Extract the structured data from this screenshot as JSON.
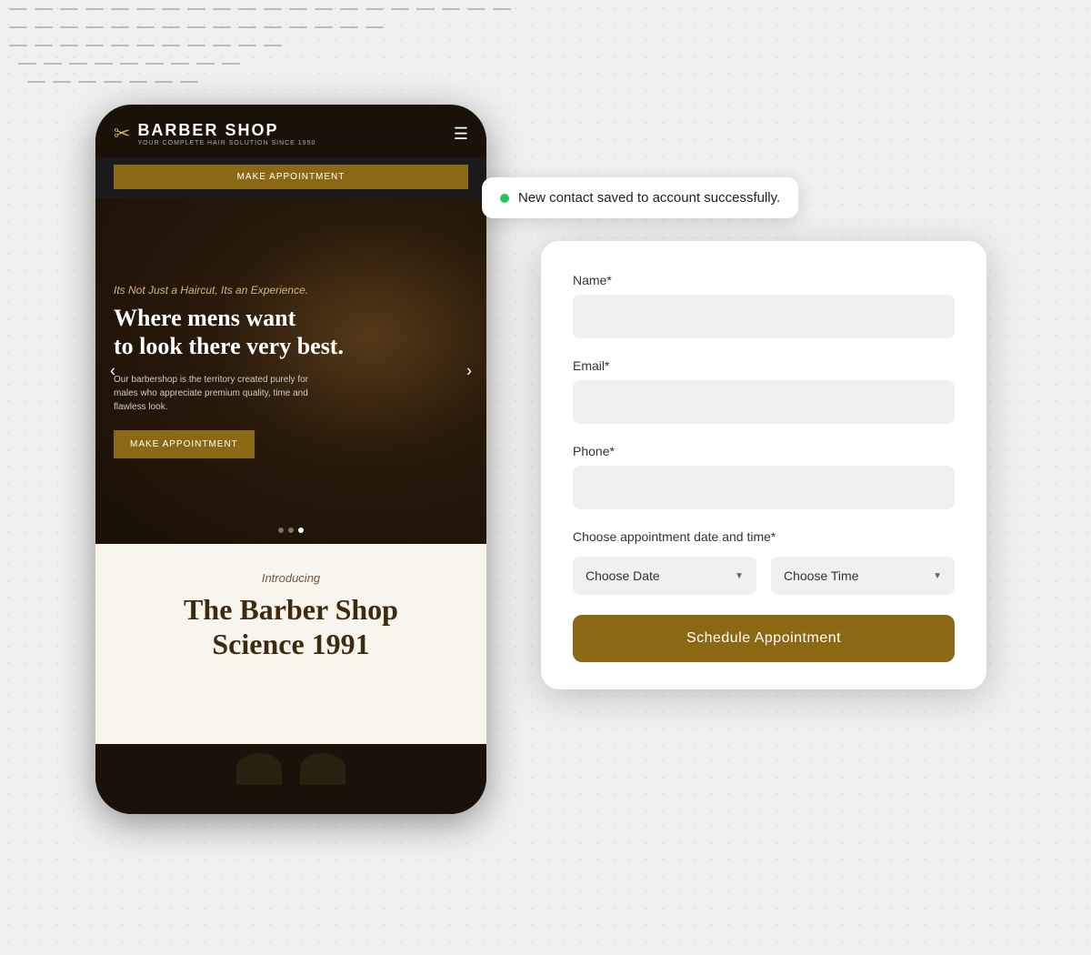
{
  "background": {
    "color": "#f0f0f0"
  },
  "toast": {
    "message": "New contact saved to account successfully.",
    "dot_color": "#22c55e"
  },
  "phone": {
    "logo_title": "BARBER SHOP",
    "logo_subtitle": "YOUR COMPLETE HAIR SOLUTION SINCE 1950",
    "nav_button": "MAKE APPOINTMENT",
    "hero": {
      "tagline": "Its Not Just a Haircut, Its an Experience.",
      "heading": "Where mens want\nto look there very best.",
      "description": "Our barbershop is the territory created purely for males who appreciate premium quality, time and flawless look.",
      "cta_button": "MAKE APPOINTMENT"
    },
    "bottom": {
      "introducing": "Introducing",
      "title_line1": "The Barber Shop",
      "title_line2": "Science 1991"
    }
  },
  "form": {
    "name_label": "Name*",
    "name_placeholder": "",
    "email_label": "Email*",
    "email_placeholder": "",
    "phone_label": "Phone*",
    "phone_placeholder": "",
    "datetime_label": "Choose appointment date and time*",
    "choose_date": "Choose Date",
    "choose_time": "Choose Time",
    "submit_button": "Schedule Appointment"
  }
}
